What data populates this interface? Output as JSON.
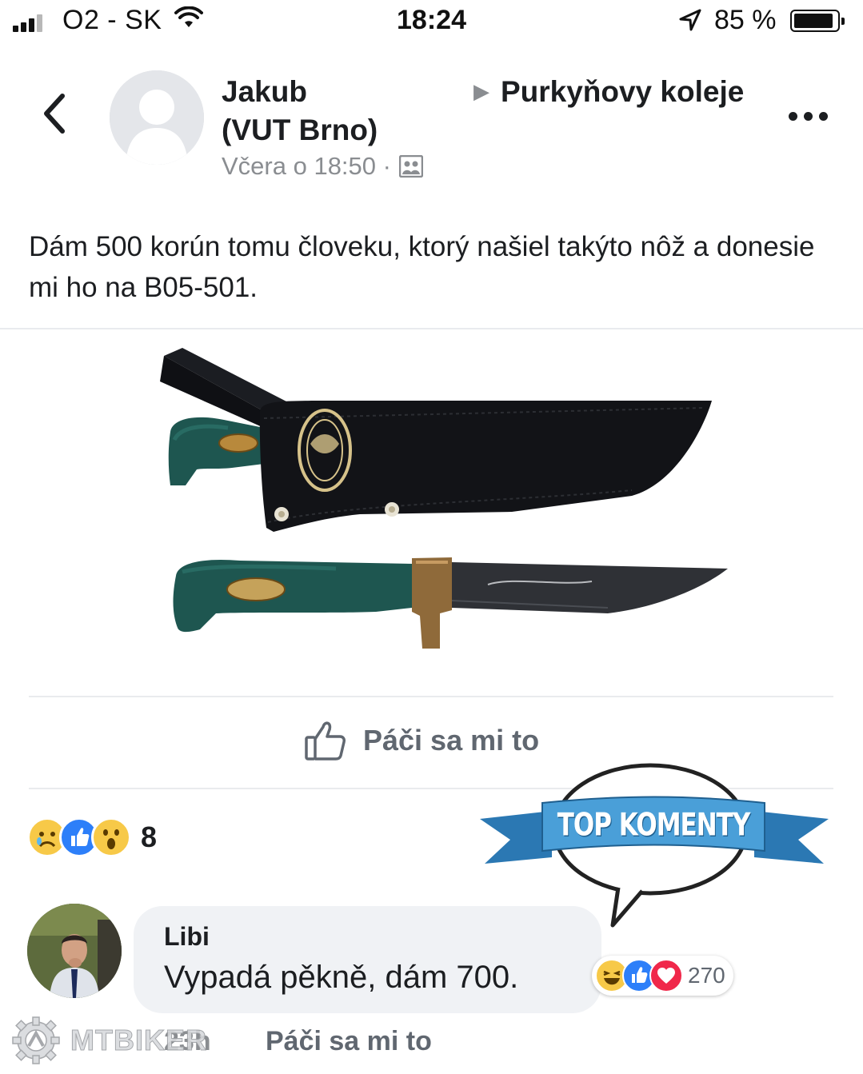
{
  "status_bar": {
    "carrier": "O2 - SK",
    "time": "18:24",
    "battery": "85 %"
  },
  "post": {
    "author": "Jakub",
    "group": "Purkyňovy koleje (VUT Brno)",
    "timestamp": "Včera o 18:50 ·",
    "text": "Dám 500 korún tomu človeku, ktorý našiel takýto nôž a donesie mi ho na B05-501.",
    "like_label": "Páči sa mi to",
    "reaction_count": "8"
  },
  "sticker": {
    "text": "TOP KOMENTY",
    "colors": {
      "ribbon": "#4a9fd8",
      "ribbon_dark": "#2b78b3"
    }
  },
  "comment": {
    "author": "Libi",
    "text": "Vypadá pěkně, dám 700.",
    "reaction_count": "270",
    "time": "23h",
    "like_label": "Páči sa mi to"
  },
  "watermark": {
    "text": "MTBIKER"
  },
  "icons": {
    "back": "chevron-left-icon",
    "more": "more-dots-icon",
    "audience": "group-audience-icon",
    "like": "thumbs-up-icon"
  },
  "colors": {
    "meta_text": "#8a8d91",
    "action_text": "#606770",
    "bubble_bg": "#f0f2f5",
    "like_blue": "#2d7ff9",
    "love_red": "#f0284a",
    "emoji_yellow": "#f7c948"
  }
}
